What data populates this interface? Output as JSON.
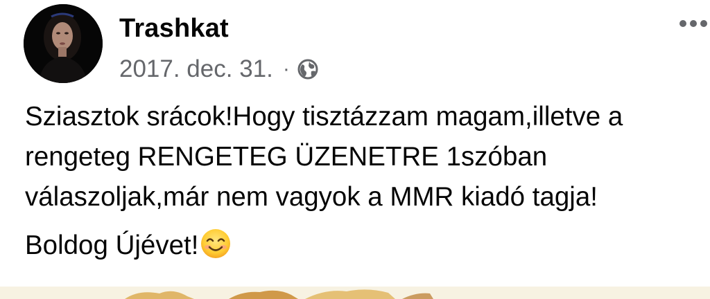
{
  "post": {
    "author": "Trashkat",
    "date": "2017. dec. 31.",
    "separator": "·",
    "privacy_icon": "globe-icon",
    "more_icon": "more-options-icon",
    "text_lines": [
      "Sziasztok srácok!Hogy tisztázzam magam,illetve a",
      "rengeteg RENGETEG ÜZENETRE 1szóban",
      "válaszoljak,már nem vagyok a MMR kiadó tagja!",
      "Boldog Újévet!"
    ],
    "emoji": "smiling-face-icon"
  }
}
